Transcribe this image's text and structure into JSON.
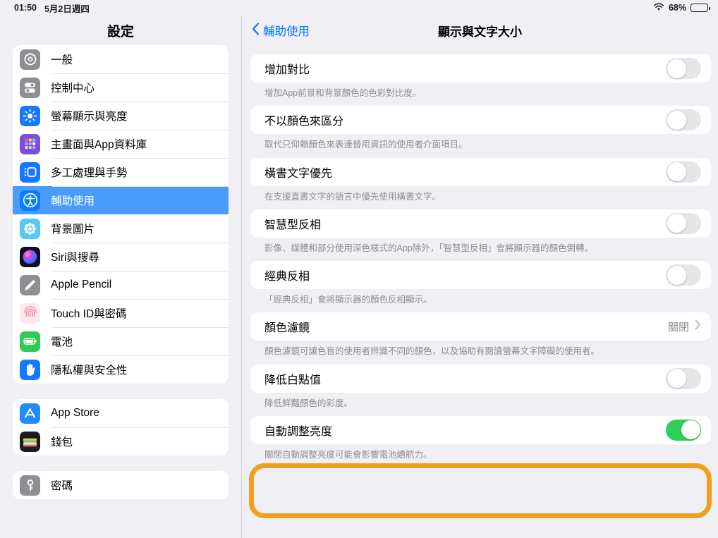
{
  "status_bar": {
    "time": "01:50",
    "date": "5月2日週四",
    "wifi_icon": "wifi-icon",
    "battery_percent": "68%",
    "battery_icon": "battery-icon",
    "battery_level": 68
  },
  "sidebar": {
    "title": "設定",
    "groups": [
      {
        "items": [
          {
            "label": "一般",
            "icon": "gear-icon",
            "color": "#8e8e93",
            "selected": false
          },
          {
            "label": "控制中心",
            "icon": "control-center-icon",
            "color": "#8e8e93",
            "selected": false
          },
          {
            "label": "螢幕顯示與亮度",
            "icon": "brightness-sun-icon",
            "color": "#1677ff",
            "selected": false
          },
          {
            "label": "主畫面與App資料庫",
            "icon": "app-library-grid-icon",
            "color": "#7a4fe0",
            "selected": false
          },
          {
            "label": "多工處理與手勢",
            "icon": "multitasking-icon",
            "color": "#1677ff",
            "selected": false
          },
          {
            "label": "輔助使用",
            "icon": "accessibility-icon",
            "color": "#0a7cff",
            "selected": true
          },
          {
            "label": "背景圖片",
            "icon": "wallpaper-flower-icon",
            "color": "#5ac8f5",
            "selected": false
          },
          {
            "label": "Siri與搜尋",
            "icon": "siri-orb-icon",
            "color": "#1c1c24",
            "selected": false
          },
          {
            "label": "Apple Pencil",
            "icon": "pencil-icon",
            "color": "#8e8e93",
            "selected": false
          },
          {
            "label": "Touch ID與密碼",
            "icon": "fingerprint-icon",
            "color": "#fbe9ee",
            "selected": false
          },
          {
            "label": "電池",
            "icon": "battery-green-icon",
            "color": "#34c759",
            "selected": false
          },
          {
            "label": "隱私權與安全性",
            "icon": "privacy-hand-icon",
            "color": "#1677ff",
            "selected": false
          }
        ]
      },
      {
        "items": [
          {
            "label": "App Store",
            "icon": "app-store-icon",
            "color": "#1f8bfd",
            "selected": false
          },
          {
            "label": "錢包",
            "icon": "wallet-icon",
            "color": "#1c1c1e",
            "selected": false
          }
        ]
      },
      {
        "items": [
          {
            "label": "密碼",
            "icon": "key-password-icon",
            "color": "#8e8e93",
            "selected": false
          }
        ]
      }
    ]
  },
  "detail": {
    "back_label": "輔助使用",
    "back_icon": "chevron-left-icon",
    "title": "顯示與文字大小",
    "rows": [
      {
        "title": "增加對比",
        "type": "toggle",
        "value": "off",
        "desc": "增加App前景和背景顏色的色彩對比度。"
      },
      {
        "title": "不以顏色來區分",
        "type": "toggle",
        "value": "off",
        "desc": "取代只仰賴顏色來表達替用資訊的使用者介面項目。"
      },
      {
        "title": "橫書文字優先",
        "type": "toggle",
        "value": "off",
        "desc": "在支援直書文字的語言中優先使用橫書文字。"
      },
      {
        "title": "智慧型反相",
        "type": "toggle",
        "value": "off",
        "desc": "影像、媒體和部分使用深色樣式的App除外，「智慧型反相」會將顯示器的顏色倒轉。"
      },
      {
        "title": "經典反相",
        "type": "toggle",
        "value": "off",
        "desc": "「經典反相」會將顯示器的顏色反相顯示。"
      },
      {
        "title": "顏色濾鏡",
        "type": "disclosure",
        "value": "關閉",
        "chevron_icon": "chevron-right-icon",
        "desc": "顏色濾鏡可讓色盲的使用者辨識不同的顏色，以及協助有閱讀螢幕文字障礙的使用者。"
      },
      {
        "title": "降低白點值",
        "type": "toggle",
        "value": "off",
        "desc": "降低鮮豔顏色的彩度。"
      },
      {
        "title": "自動調整亮度",
        "type": "toggle",
        "value": "on",
        "desc": "關閉自動調整亮度可能會影響電池續航力。",
        "highlighted": true
      }
    ]
  },
  "annotation": {
    "name": "orange-highlight-box",
    "color": "#f0a01e",
    "target": "自動調整亮度"
  }
}
